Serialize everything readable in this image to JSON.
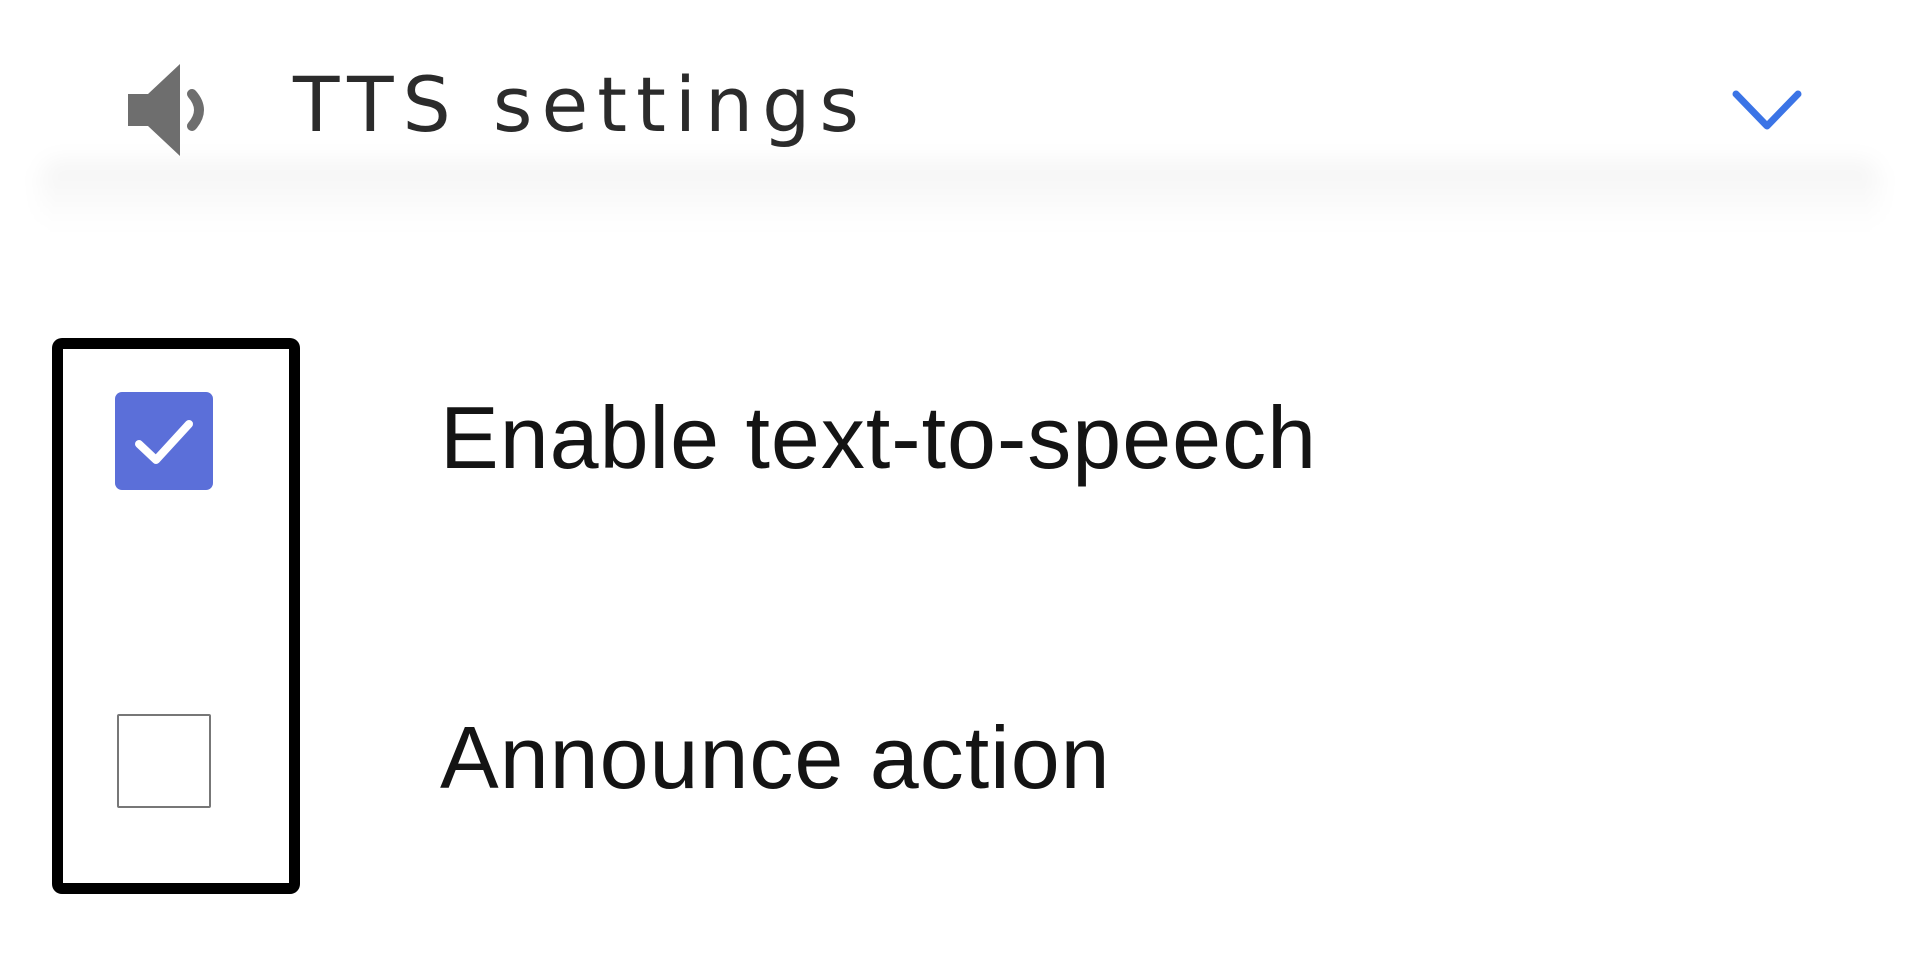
{
  "header": {
    "title": "TTS settings",
    "speaker_icon": "speaker-icon",
    "chevron_icon": "chevron-down-icon",
    "accent_color": "#3b74e6"
  },
  "options": [
    {
      "label": "Enable text-to-speech",
      "checked": true
    },
    {
      "label": "Announce action",
      "checked": false
    }
  ],
  "colors": {
    "checkbox_checked": "#5b6fd9",
    "highlight_border": "#000000"
  }
}
